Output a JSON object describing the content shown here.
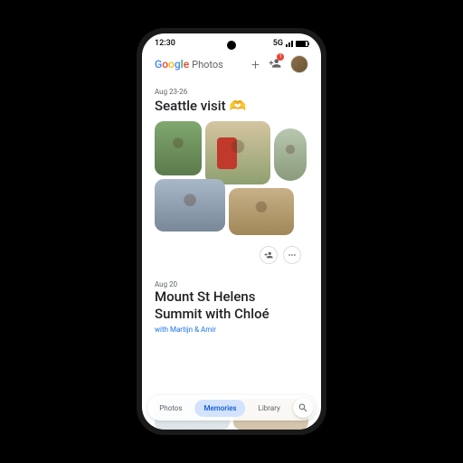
{
  "status": {
    "time": "12:30",
    "network": "5G"
  },
  "header": {
    "app_name": "Photos",
    "badge_count": "1"
  },
  "memories": [
    {
      "date": "Aug 23-26",
      "title": "Seattle visit",
      "emoji": "🫶"
    },
    {
      "date": "Aug 20",
      "title_line1": "Mount St Helens",
      "title_line2": "Summit with Chloé",
      "subtitle": "with Martijn & Amir"
    }
  ],
  "nav": {
    "items": [
      "Photos",
      "Memories",
      "Library"
    ],
    "active_index": 1
  }
}
